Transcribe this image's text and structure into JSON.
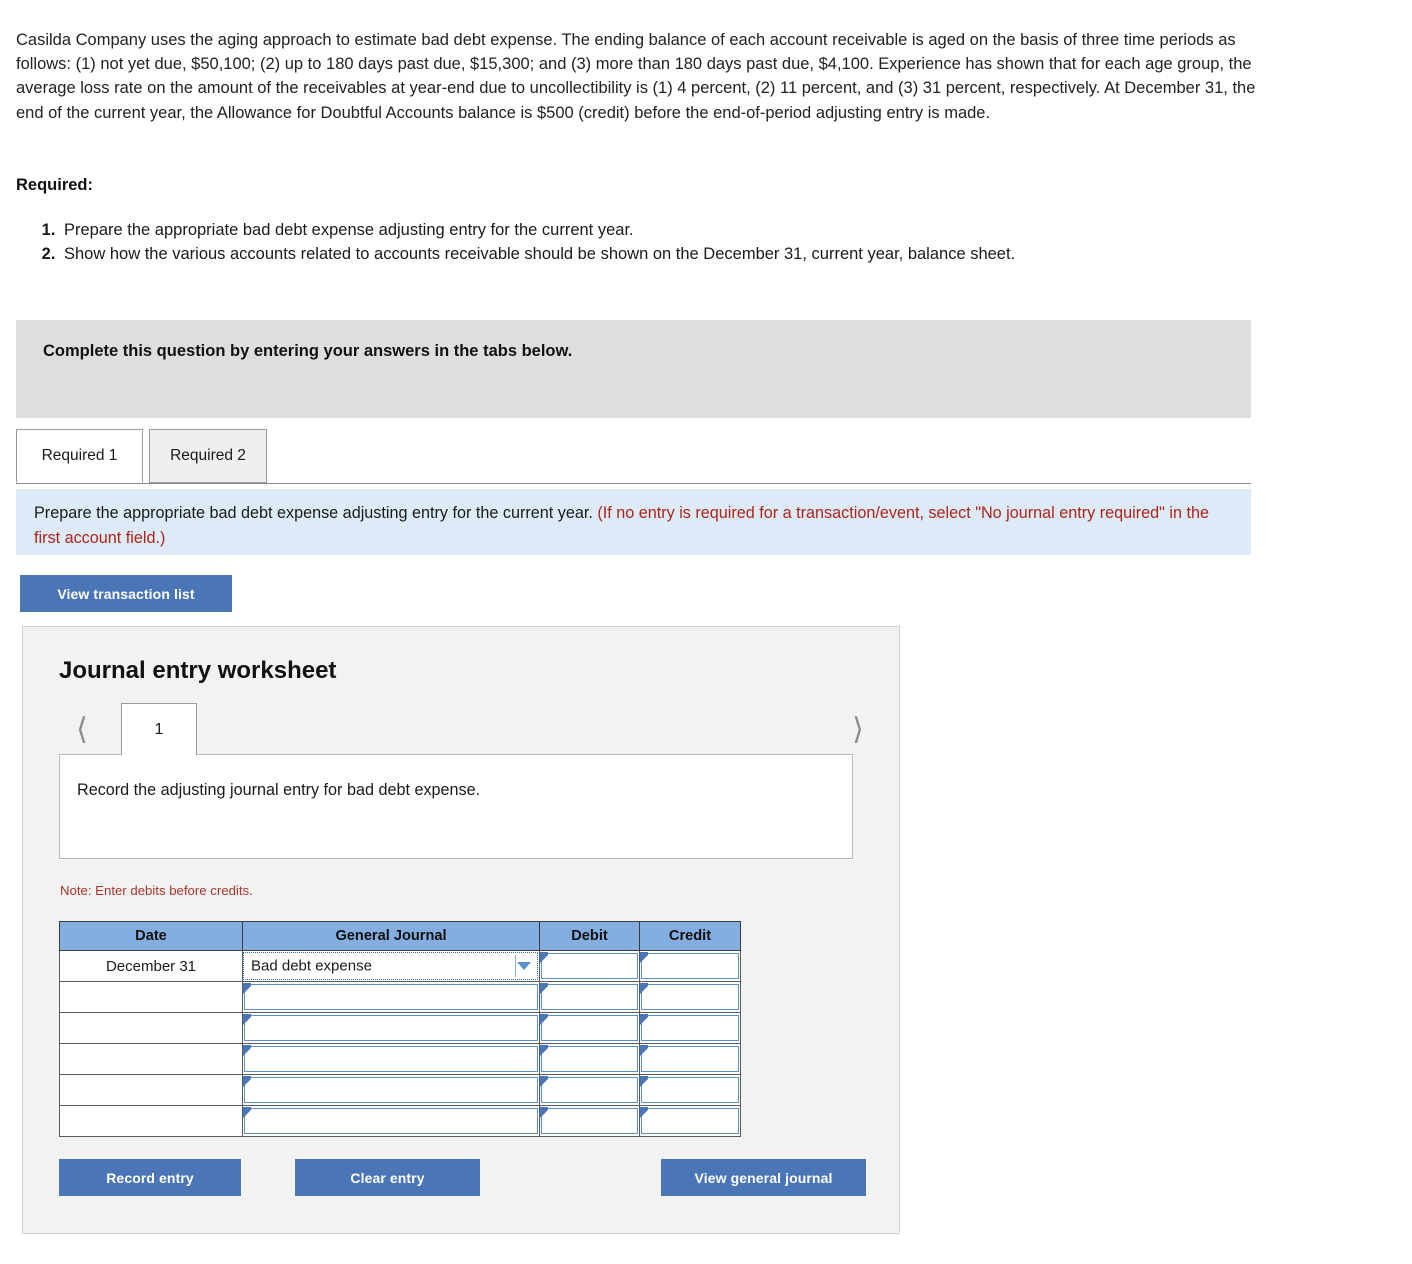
{
  "intro": {
    "paragraph": "Casilda Company uses the aging approach to estimate bad debt expense. The ending balance of each account receivable is aged on the basis of three time periods as follows: (1) not yet due, $50,100; (2) up to 180 days past due, $15,300; and (3) more than 180 days past due, $4,100. Experience has shown that for each age group, the average loss rate on the amount of the receivables at year-end due to uncollectibility is (1) 4 percent, (2) 11 percent, and (3) 31 percent, respectively. At December 31, the end of the current year, the Allowance for Doubtful Accounts balance is $500 (credit) before the end-of-period adjusting entry is made."
  },
  "required": {
    "heading": "Required:",
    "items": [
      "Prepare the appropriate bad debt expense adjusting entry for the current year.",
      "Show how the various accounts related to accounts receivable should be shown on the December 31, current year, balance sheet."
    ]
  },
  "banner": {
    "text": "Complete this question by entering your answers in the tabs below."
  },
  "tabs": [
    {
      "label": "Required 1",
      "active": true
    },
    {
      "label": "Required 2",
      "active": false
    }
  ],
  "instruction": {
    "black_text": "Prepare the appropriate bad debt expense adjusting entry for the current year.",
    "red_text": "(If no entry is required for a transaction/event, select \"No journal entry required\" in the first account field.)"
  },
  "buttons": {
    "view_transaction_list": "View transaction list",
    "record_entry": "Record entry",
    "clear_entry": "Clear entry",
    "view_general_journal": "View general journal"
  },
  "worksheet": {
    "title": "Journal entry worksheet",
    "prev_icon": "chevron-left-icon",
    "next_icon": "chevron-right-icon",
    "page_tab": "1",
    "description": "Record the adjusting journal entry for bad debt expense.",
    "note": "Note: Enter debits before credits."
  },
  "journal": {
    "columns": [
      "Date",
      "General Journal",
      "Debit",
      "Credit"
    ],
    "rows": [
      {
        "date": "December 31",
        "account": "Bad debt expense",
        "debit": "",
        "credit": "",
        "has_dropdown": true,
        "focused": true
      },
      {
        "date": "",
        "account": "",
        "debit": "",
        "credit": "",
        "has_dropdown": false,
        "focused": false
      },
      {
        "date": "",
        "account": "",
        "debit": "",
        "credit": "",
        "has_dropdown": false,
        "focused": false
      },
      {
        "date": "",
        "account": "",
        "debit": "",
        "credit": "",
        "has_dropdown": false,
        "focused": false
      },
      {
        "date": "",
        "account": "",
        "debit": "",
        "credit": "",
        "has_dropdown": false,
        "focused": false
      },
      {
        "date": "",
        "account": "",
        "debit": "",
        "credit": "",
        "has_dropdown": false,
        "focused": false
      }
    ]
  },
  "colors": {
    "button_blue": "#4a76b8",
    "table_header_blue": "#85aee0",
    "info_panel_blue": "#dcebf7",
    "banner_grey": "#dedede",
    "panel_grey": "#f2f2f2",
    "red_text": "#b02418",
    "note_red": "#a9372b",
    "cell_border_blue": "#5b8fc9"
  }
}
